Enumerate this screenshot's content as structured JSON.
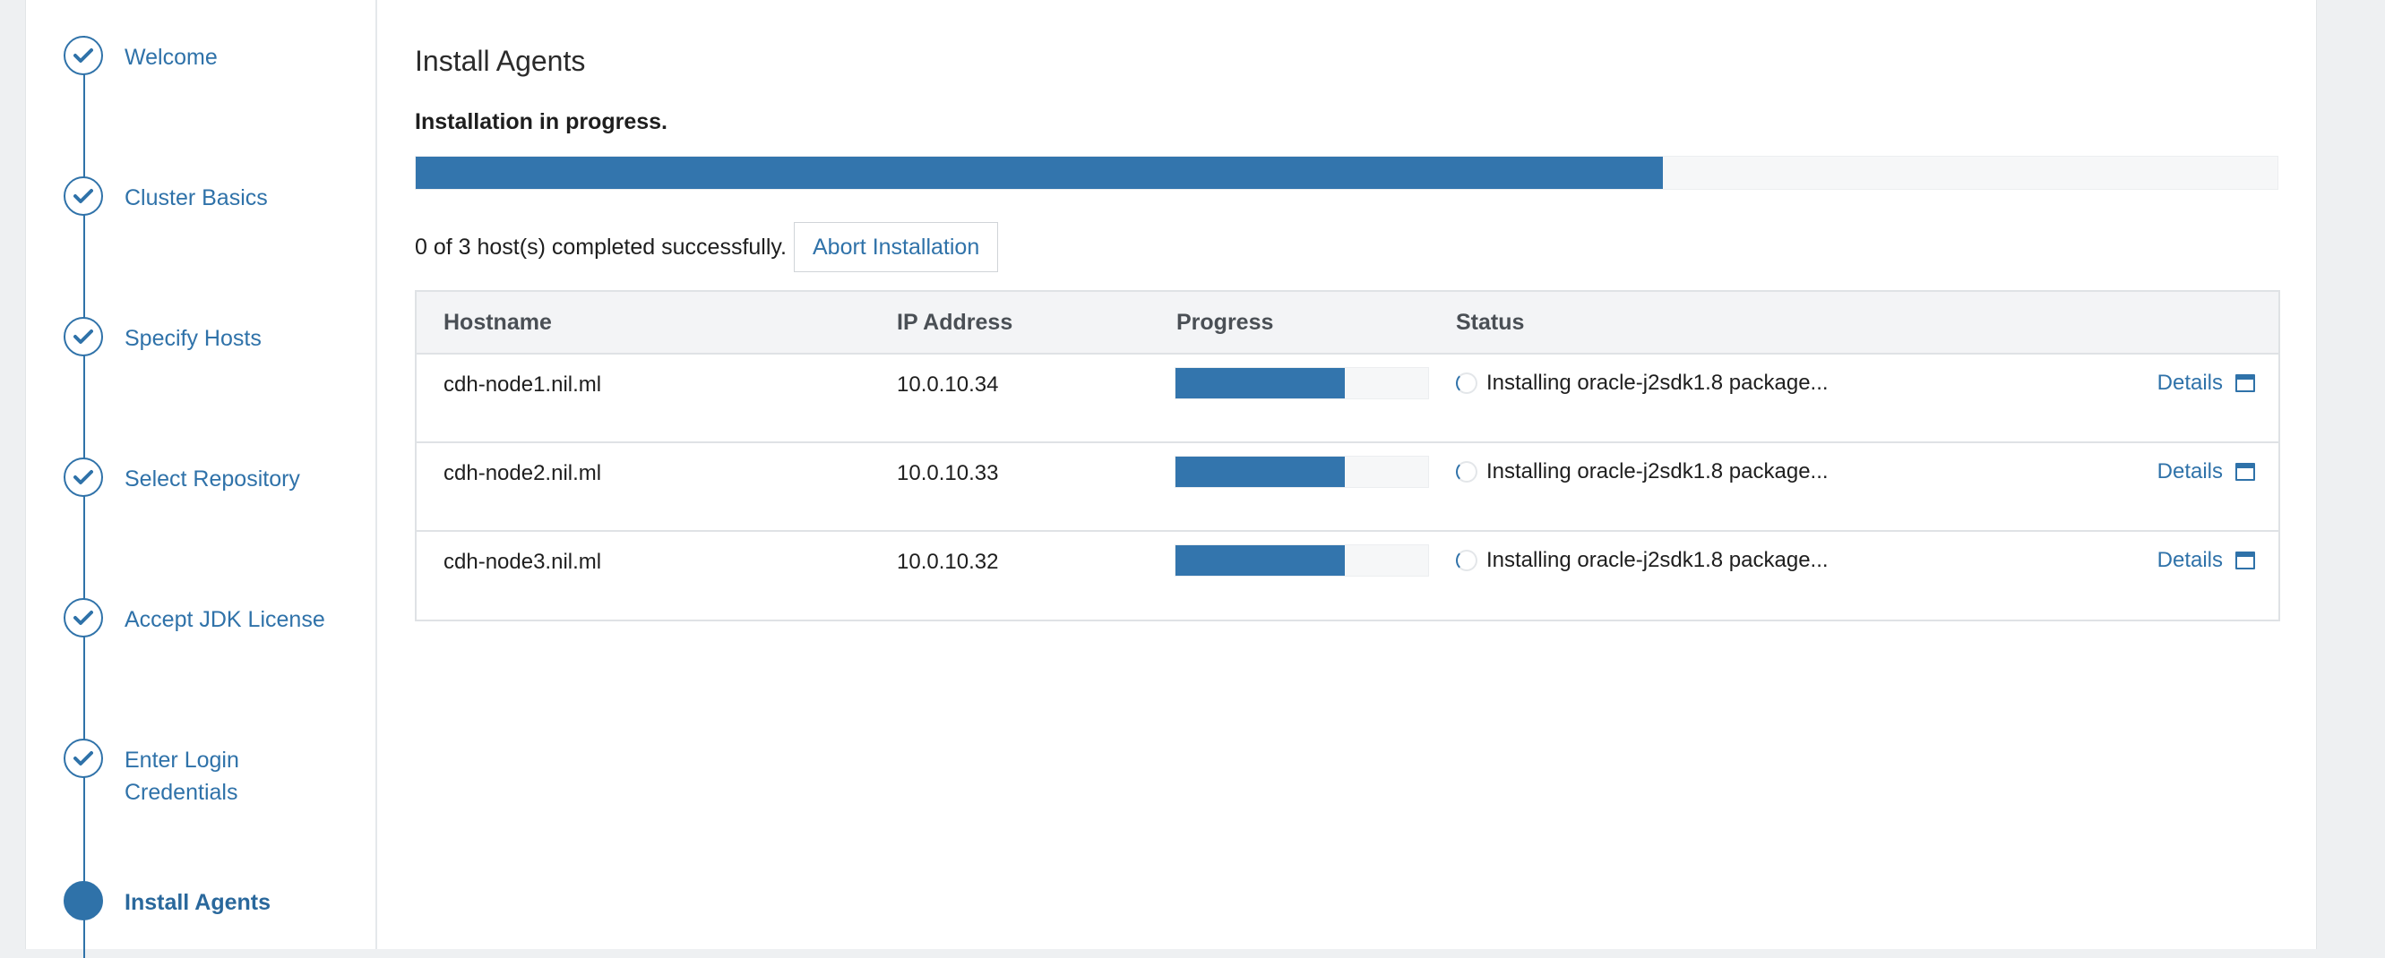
{
  "steps": [
    {
      "label": "Welcome",
      "state": "done"
    },
    {
      "label": "Cluster Basics",
      "state": "done"
    },
    {
      "label": "Specify Hosts",
      "state": "done"
    },
    {
      "label": "Select Repository",
      "state": "done"
    },
    {
      "label": "Accept JDK License",
      "state": "done"
    },
    {
      "label": "Enter Login Credentials",
      "state": "done"
    },
    {
      "label": "Install Agents",
      "state": "active"
    }
  ],
  "page": {
    "title": "Install Agents",
    "status": "Installation in progress.",
    "overall_progress": 0.67,
    "summary": "0 of 3 host(s) completed successfully.",
    "abort_label": "Abort Installation"
  },
  "table": {
    "headers": {
      "hostname": "Hostname",
      "ip": "IP Address",
      "progress": "Progress",
      "status": "Status"
    },
    "rows": [
      {
        "hostname": "cdh-node1.nil.ml",
        "ip": "10.0.10.34",
        "progress": 0.67,
        "status": "Installing oracle-j2sdk1.8 package...",
        "details": "Details"
      },
      {
        "hostname": "cdh-node2.nil.ml",
        "ip": "10.0.10.33",
        "progress": 0.67,
        "status": "Installing oracle-j2sdk1.8 package...",
        "details": "Details"
      },
      {
        "hostname": "cdh-node3.nil.ml",
        "ip": "10.0.10.32",
        "progress": 0.67,
        "status": "Installing oracle-j2sdk1.8 package...",
        "details": "Details"
      }
    ]
  },
  "colors": {
    "accent": "#2f72a9",
    "progress_fill": "#3375ad"
  },
  "icons": {
    "done": "check-icon",
    "details": "window-icon"
  }
}
